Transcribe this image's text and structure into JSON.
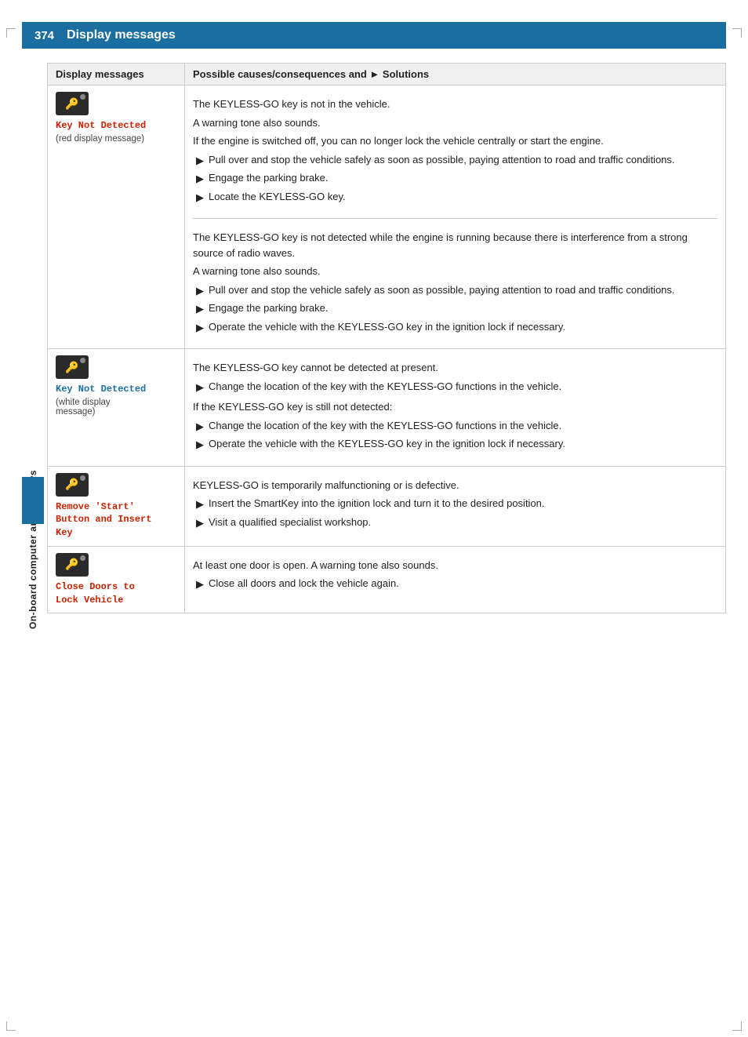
{
  "page": {
    "number": "374",
    "title": "Display messages",
    "sidebar_label": "On-board computer and displays"
  },
  "table": {
    "col1_header": "Display messages",
    "col2_header": "Possible causes/consequences and ► Solutions",
    "rows": [
      {
        "id": "row1",
        "display_message": "Key Not Detected",
        "display_caption": "(red display message)",
        "message_color": "red",
        "sections": [
          {
            "id": "sec1a",
            "intro_lines": [
              "The KEYLESS-GO key is not in the vehicle.",
              "A warning tone also sounds.",
              "If the engine is switched off, you can no longer lock the vehicle centrally or start the engine."
            ],
            "bullets": [
              "Pull over and stop the vehicle safely as soon as possible, paying attention to road and traffic conditions.",
              "Engage the parking brake.",
              "Locate the KEYLESS-GO key."
            ]
          },
          {
            "id": "sec1b",
            "intro_lines": [
              "The KEYLESS-GO key is not detected while the engine is running because there is interference from a strong source of radio waves.",
              "A warning tone also sounds."
            ],
            "bullets": [
              "Pull over and stop the vehicle safely as soon as possible, paying attention to road and traffic conditions.",
              "Engage the parking brake.",
              "Operate the vehicle with the KEYLESS-GO key in the ignition lock if necessary."
            ]
          }
        ]
      },
      {
        "id": "row2",
        "display_message": "Key Not Detected",
        "display_caption": "(white display\nmessage)",
        "message_color": "white",
        "sections": [
          {
            "id": "sec2a",
            "intro_lines": [
              "The KEYLESS-GO key cannot be detected at present."
            ],
            "bullets": [
              "Change the location of the key with the KEYLESS-GO functions in the vehicle."
            ],
            "after_bullets_intro": "If the KEYLESS-GO key is still not detected:",
            "after_bullets": [
              "Change the location of the key with the KEYLESS-GO functions in the vehicle.",
              "Operate the vehicle with the KEYLESS-GO key in the ignition lock if necessary."
            ]
          }
        ]
      },
      {
        "id": "row3",
        "display_message": "Remove 'Start'\nButton and Insert\nKey",
        "display_caption": "",
        "message_color": "red",
        "sections": [
          {
            "id": "sec3a",
            "intro_lines": [
              "KEYLESS-GO is temporarily malfunctioning or is defective."
            ],
            "bullets": [
              "Insert the SmartKey into the ignition lock and turn it to the desired position.",
              "Visit a qualified specialist workshop."
            ]
          }
        ]
      },
      {
        "id": "row4",
        "display_message": "Close Doors to\nLock Vehicle",
        "display_caption": "",
        "message_color": "red",
        "sections": [
          {
            "id": "sec4a",
            "intro_lines": [
              "At least one door is open. A warning tone also sounds."
            ],
            "bullets": [
              "Close all doors and lock the vehicle again."
            ]
          }
        ]
      }
    ]
  }
}
